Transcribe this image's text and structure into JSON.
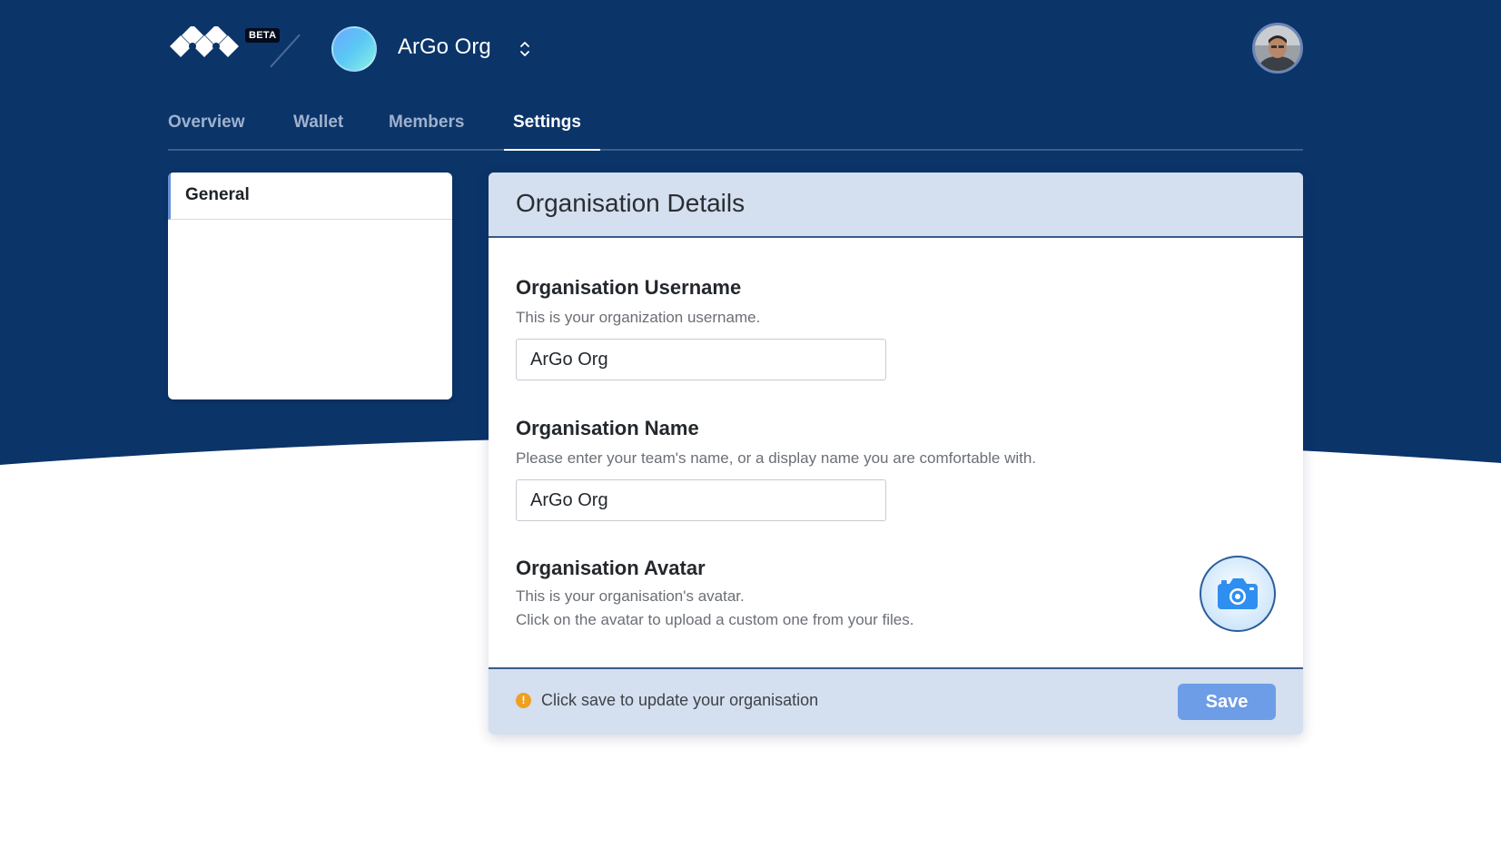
{
  "header": {
    "badge": "BETA",
    "org_name": "ArGo Org"
  },
  "tabs": [
    {
      "label": "Overview"
    },
    {
      "label": "Wallet"
    },
    {
      "label": "Members"
    },
    {
      "label": "Settings",
      "active": true
    }
  ],
  "sidebar": {
    "items": [
      {
        "label": "General",
        "active": true
      }
    ]
  },
  "card": {
    "title": "Organisation Details",
    "username": {
      "title": "Organisation Username",
      "description": "This is your organization username.",
      "value": "ArGo Org"
    },
    "name": {
      "title": "Organisation Name",
      "description": "Please enter your team's name, or a display name you are comfortable with.",
      "value": "ArGo Org"
    },
    "avatar": {
      "title": "Organisation Avatar",
      "description_1": "This is your organisation's avatar.",
      "description_2": "Click on the avatar to upload a custom one from your files.",
      "icon": "camera-icon"
    },
    "footer": {
      "message": "Click save to update your organisation",
      "save_label": "Save"
    }
  },
  "colors": {
    "hero_background": "#0b3469",
    "accent": "#6c9de6",
    "card_header": "#d4dfef",
    "warning": "#f0a020"
  }
}
